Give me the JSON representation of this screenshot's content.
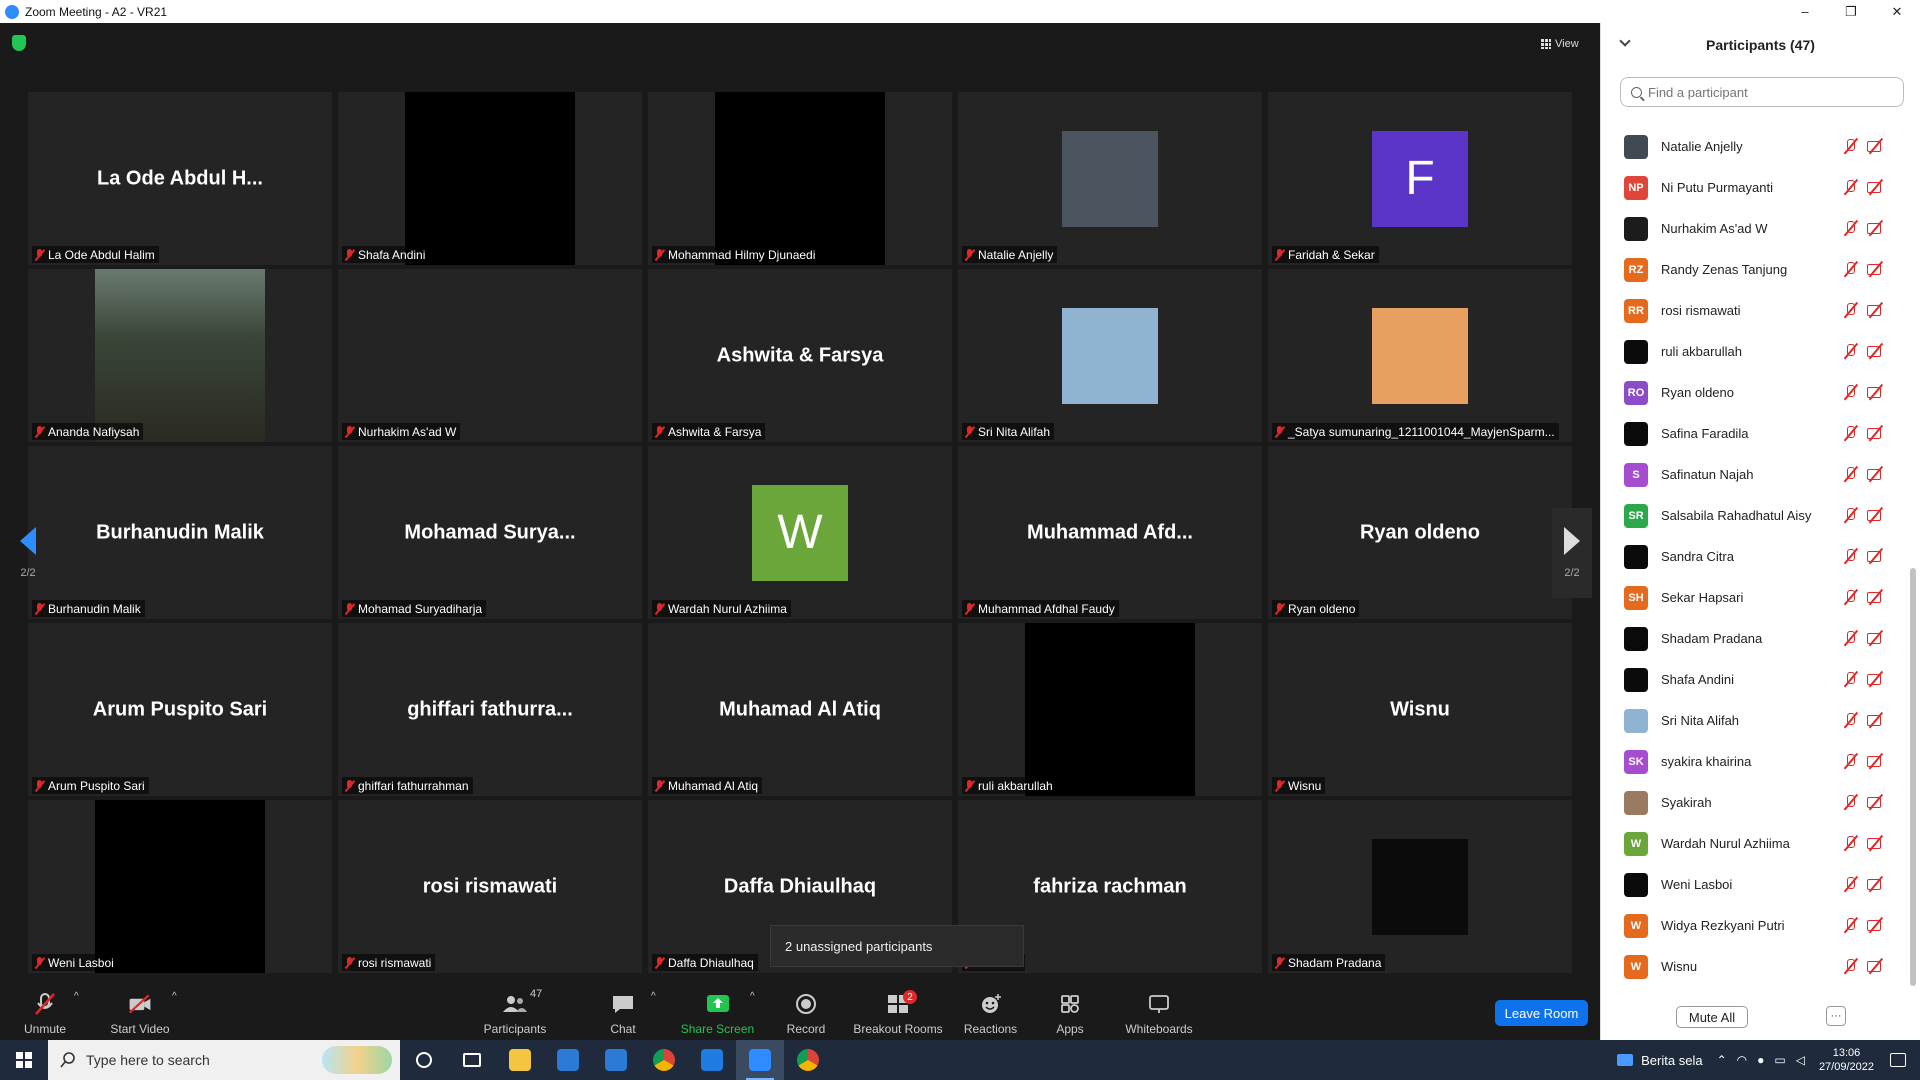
{
  "window": {
    "title": "Zoom Meeting - A2 - VR21",
    "controls": [
      "–",
      "❐",
      "✕"
    ]
  },
  "meeting": {
    "view_label": "View",
    "page_indicator_left": "2/2",
    "page_indicator_right": "2/2",
    "tooltip": "2 unassigned participants",
    "tiles": [
      {
        "display": "La Ode Abdul H...",
        "label": "La Ode Abdul Halim",
        "kind": "name"
      },
      {
        "display": "",
        "label": "Shafa Andini",
        "kind": "black"
      },
      {
        "display": "",
        "label": "Mohammad Hilmy Djunaedi",
        "kind": "black"
      },
      {
        "display": "",
        "label": "Natalie Anjelly",
        "kind": "photo",
        "color": "#4a5560"
      },
      {
        "display": "F",
        "label": "Faridah & Sekar",
        "kind": "avatar",
        "color": "#5a35c8"
      },
      {
        "display": "",
        "label": "Ananda Nafiysah",
        "kind": "video",
        "color": "#3e4a3a"
      },
      {
        "display": "",
        "label": "Nurhakim As'ad W",
        "kind": "empty"
      },
      {
        "display": "Ashwita & Farsya",
        "label": "Ashwita & Farsya",
        "kind": "name"
      },
      {
        "display": "",
        "label": "Sri Nita Alifah",
        "kind": "photo",
        "color": "#8fb3d1"
      },
      {
        "display": "",
        "label": "_Satya sumunaring_1211001044_MayjenSparm...",
        "kind": "photo",
        "color": "#e8a060"
      },
      {
        "display": "Burhanudin Malik",
        "label": "Burhanudin Malik",
        "kind": "name"
      },
      {
        "display": "Mohamad  Surya...",
        "label": "Mohamad Suryadiharja",
        "kind": "name"
      },
      {
        "display": "W",
        "label": "Wardah Nurul Azhiima",
        "kind": "avatar",
        "color": "#6aa63a"
      },
      {
        "display": "Muhammad  Afd...",
        "label": "Muhammad Afdhal Faudy",
        "kind": "name"
      },
      {
        "display": "Ryan oldeno",
        "label": "Ryan oldeno",
        "kind": "name"
      },
      {
        "display": "Arum Puspito Sari",
        "label": "Arum Puspito Sari",
        "kind": "name"
      },
      {
        "display": "ghiffari  fathurra...",
        "label": "ghiffari fathurrahman",
        "kind": "name"
      },
      {
        "display": "Muhamad Al Atiq",
        "label": "Muhamad Al Atiq",
        "kind": "name"
      },
      {
        "display": "",
        "label": "ruli akbarullah",
        "kind": "black"
      },
      {
        "display": "Wisnu",
        "label": "Wisnu",
        "kind": "name"
      },
      {
        "display": "",
        "label": "Weni Lasboi",
        "kind": "black"
      },
      {
        "display": "rosi rismawati",
        "label": "rosi rismawati",
        "kind": "name"
      },
      {
        "display": "Daffa Dhiaulhaq",
        "label": "Daffa Dhiaulhaq",
        "kind": "name"
      },
      {
        "display": "fahriza rachman",
        "label": "achman",
        "kind": "name"
      },
      {
        "display": "",
        "label": "Shadam Pradana",
        "kind": "photo",
        "color": "#0b0b0b"
      }
    ]
  },
  "toolbar": {
    "unmute": "Unmute",
    "start_video": "Start Video",
    "participants": "Participants",
    "participants_count": "47",
    "chat": "Chat",
    "share_screen": "Share Screen",
    "record": "Record",
    "breakout_rooms": "Breakout Rooms",
    "breakout_badge": "2",
    "reactions": "Reactions",
    "apps": "Apps",
    "whiteboards": "Whiteboards",
    "leave_room": "Leave Room",
    "accent": "#0e72ed",
    "share_color": "#23c552"
  },
  "panel": {
    "title": "Participants (47)",
    "search_placeholder": "Find a participant",
    "mute_all": "Mute All",
    "more": "···",
    "participants": [
      {
        "name": "Natalie Anjelly",
        "initials": "",
        "color": "#3f4a52"
      },
      {
        "name": "Ni Putu Purmayanti",
        "initials": "NP",
        "color": "#e0453a"
      },
      {
        "name": "Nurhakim As'ad W",
        "initials": "",
        "color": "#1c1c1c"
      },
      {
        "name": "Randy Zenas Tanjung",
        "initials": "RZ",
        "color": "#e56a1e"
      },
      {
        "name": "rosi rismawati",
        "initials": "RR",
        "color": "#e56a1e"
      },
      {
        "name": "ruli akbarullah",
        "initials": "",
        "color": "#0a0a0a"
      },
      {
        "name": "Ryan oldeno",
        "initials": "RO",
        "color": "#8a4cc7"
      },
      {
        "name": "Safina Faradila",
        "initials": "",
        "color": "#0a0a0a"
      },
      {
        "name": "Safinatun Najah",
        "initials": "S",
        "color": "#a64ccf"
      },
      {
        "name": "Salsabila Rahadhatul Aisy",
        "initials": "SR",
        "color": "#2aa84a"
      },
      {
        "name": "Sandra Citra",
        "initials": "",
        "color": "#0a0a0a"
      },
      {
        "name": "Sekar Hapsari",
        "initials": "SH",
        "color": "#e56a1e"
      },
      {
        "name": "Shadam Pradana",
        "initials": "",
        "color": "#0a0a0a"
      },
      {
        "name": "Shafa Andini",
        "initials": "",
        "color": "#0a0a0a"
      },
      {
        "name": "Sri Nita Alifah",
        "initials": "",
        "color": "#8fb3d1"
      },
      {
        "name": "syakira khairina",
        "initials": "SK",
        "color": "#a64ccf"
      },
      {
        "name": "Syakirah",
        "initials": "",
        "color": "#9a7a60"
      },
      {
        "name": "Wardah Nurul Azhiima",
        "initials": "W",
        "color": "#6aa63a"
      },
      {
        "name": "Weni Lasboi",
        "initials": "",
        "color": "#0a0a0a"
      },
      {
        "name": "Widya Rezkyani Putri",
        "initials": "W",
        "color": "#e56a1e"
      },
      {
        "name": "Wisnu",
        "initials": "W",
        "color": "#e56a1e"
      }
    ]
  },
  "taskbar": {
    "search_placeholder": "Type here to search",
    "news": "Berita sela",
    "time": "13:06",
    "date": "27/09/2022",
    "apps": [
      {
        "name": "cortana",
        "color": "#ffffff"
      },
      {
        "name": "task-view",
        "color": "#ffffff"
      },
      {
        "name": "file-explorer",
        "color": "#f5c542"
      },
      {
        "name": "store",
        "color": "#2b7bd6"
      },
      {
        "name": "mail",
        "color": "#2b7bd6"
      },
      {
        "name": "chrome",
        "color": "#e9b92c"
      },
      {
        "name": "teamviewer",
        "color": "#1f7be0"
      },
      {
        "name": "zoom",
        "color": "#2d8cff"
      },
      {
        "name": "chrome-alt",
        "color": "#d9463b"
      }
    ]
  }
}
